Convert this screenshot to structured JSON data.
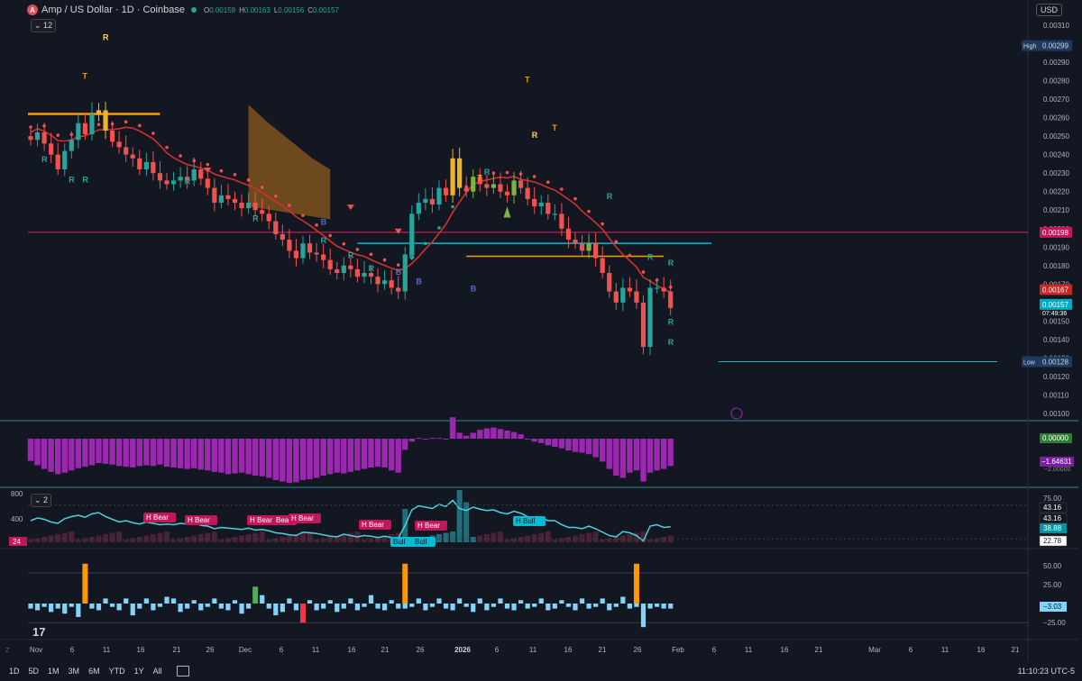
{
  "header": {
    "symbol": "Amp / US Dollar · 1D · Coinbase",
    "ohlc": [
      {
        "k": "O",
        "v": "0.00159"
      },
      {
        "k": "H",
        "v": "0.00163"
      },
      {
        "k": "L",
        "v": "0.00156"
      },
      {
        "k": "C",
        "v": "0.00157"
      }
    ],
    "collapse_count": "12",
    "currency": "USD"
  },
  "chart_data": [
    {
      "type": "candlestick",
      "pane": "price",
      "y_ticks": [
        "0.00310",
        "0.00300",
        "0.00290",
        "0.00280",
        "0.00270",
        "0.00260",
        "0.00250",
        "0.00240",
        "0.00230",
        "0.00220",
        "0.00210",
        "0.00200",
        "0.00190",
        "0.00180",
        "0.00170",
        "0.00160",
        "0.00150",
        "0.00140",
        "0.00130",
        "0.00120",
        "0.00110",
        "0.00100"
      ],
      "ylim": [
        0.001,
        0.0031
      ],
      "x_ticks": [
        "Nov",
        "6",
        "11",
        "16",
        "21",
        "26",
        "Dec",
        "6",
        "11",
        "16",
        "21",
        "26",
        "2026",
        "6",
        "11",
        "16",
        "21",
        "26",
        "Feb",
        "6",
        "11",
        "16",
        "21",
        "Mar",
        "6",
        "11",
        "16",
        "21"
      ],
      "close": [
        0.00248,
        0.00252,
        0.00246,
        0.0024,
        0.00232,
        0.00242,
        0.00248,
        0.00257,
        0.00251,
        0.00262,
        0.00264,
        0.00253,
        0.00247,
        0.00244,
        0.0024,
        0.00238,
        0.00232,
        0.00236,
        0.0023,
        0.00226,
        0.00224,
        0.00226,
        0.00228,
        0.00226,
        0.00232,
        0.00227,
        0.00222,
        0.00214,
        0.00218,
        0.00216,
        0.00214,
        0.00211,
        0.00214,
        0.0021,
        0.00208,
        0.00204,
        0.00197,
        0.00194,
        0.00188,
        0.00184,
        0.00192,
        0.00187,
        0.00186,
        0.00183,
        0.00178,
        0.00176,
        0.0018,
        0.00178,
        0.00174,
        0.00176,
        0.00174,
        0.0017,
        0.00172,
        0.00168,
        0.00166,
        0.00186,
        0.00208,
        0.00214,
        0.00216,
        0.00213,
        0.00222,
        0.00218,
        0.00238,
        0.00222,
        0.0022,
        0.00228,
        0.00224,
        0.00222,
        0.00224,
        0.0022,
        0.00218,
        0.00226,
        0.00222,
        0.00216,
        0.00212,
        0.00214,
        0.00208,
        0.00208,
        0.002,
        0.00194,
        0.00192,
        0.00188,
        0.00192,
        0.00184,
        0.00176,
        0.00166,
        0.0016,
        0.00168,
        0.00166,
        0.0016,
        0.00136,
        0.00168,
        0.00168,
        0.00166,
        0.00157
      ],
      "levels": {
        "magenta": 0.00198,
        "cyan": 0.00192,
        "orange": 0.00185,
        "orange_top": 0.00262
      },
      "price_tags": {
        "high": "High",
        "high_val": "0.00299",
        "red": "0.00198",
        "red2": "0.00167",
        "cur": "0.00157",
        "cur_sub": "07:49:36",
        "low": "Low",
        "low_val": "0.00128"
      },
      "markers": {
        "R": "R",
        "T": "T",
        "B": "B"
      }
    },
    {
      "type": "bar",
      "pane": "momentum",
      "values": [
        -3.0,
        -3.6,
        -4.1,
        -4.5,
        -4.8,
        -4.6,
        -4.3,
        -4.0,
        -3.8,
        -3.6,
        -3.3,
        -3.4,
        -3.5,
        -3.7,
        -3.8,
        -3.9,
        -3.7,
        -3.6,
        -3.7,
        -3.5,
        -3.8,
        -3.9,
        -4.0,
        -4.1,
        -4.0,
        -4.2,
        -4.3,
        -4.5,
        -4.6,
        -4.8,
        -4.7,
        -4.6,
        -4.8,
        -5.0,
        -5.1,
        -5.3,
        -5.6,
        -5.8,
        -6.0,
        -5.9,
        -5.6,
        -5.5,
        -5.3,
        -5.0,
        -4.8,
        -4.6,
        -4.7,
        -4.5,
        -4.3,
        -4.1,
        -3.9,
        -3.8,
        -3.9,
        -4.3,
        -4.6,
        -1.5,
        -0.4,
        0.1,
        0.0,
        0.1,
        0.1,
        0.0,
        2.9,
        0.8,
        0.4,
        0.8,
        1.2,
        1.4,
        1.5,
        1.3,
        1.1,
        0.9,
        0.6,
        0.0,
        -0.4,
        -0.6,
        -0.9,
        -1.1,
        -1.3,
        -1.6,
        -1.8,
        -1.9,
        -2.1,
        -2.5,
        -3.1,
        -4.1,
        -5.0,
        -5.3,
        -4.6,
        -4.3,
        -5.8,
        -4.6,
        -4.3,
        -4.1,
        -3.7
      ],
      "labels": {
        "zero": "0.00000",
        "last": "−1.64631",
        "axis_min": "−2.00000"
      }
    },
    {
      "type": "area",
      "pane": "rsi-divergence",
      "indicator_count": "2",
      "left_labels": [
        "800",
        "400",
        "24"
      ],
      "axis": [
        "75.00",
        "43.16",
        "43.16",
        "38.88",
        "22.78",
        "25.00"
      ],
      "values": [
        52,
        56,
        54,
        50,
        48,
        55,
        58,
        60,
        57,
        62,
        64,
        58,
        54,
        50,
        52,
        49,
        47,
        50,
        48,
        46,
        47,
        46,
        48,
        47,
        49,
        45,
        44,
        40,
        42,
        41,
        40,
        39,
        41,
        38,
        39,
        37,
        34,
        33,
        31,
        30,
        35,
        34,
        33,
        31,
        29,
        28,
        32,
        30,
        28,
        30,
        29,
        27,
        29,
        27,
        26,
        45,
        68,
        74,
        72,
        70,
        76,
        73,
        82,
        70,
        67,
        72,
        69,
        67,
        68,
        64,
        62,
        66,
        63,
        58,
        55,
        56,
        52,
        52,
        46,
        42,
        42,
        40,
        44,
        40,
        35,
        30,
        28,
        36,
        34,
        30,
        22,
        44,
        46,
        42,
        43
      ],
      "divergence_tags": [
        "H Bear",
        "H Bear",
        "H Bear",
        "Bear",
        "H Bear",
        "H Bear",
        "H Bear",
        "Bull",
        "Bull",
        "H Bull"
      ]
    },
    {
      "type": "bar",
      "pane": "oscillator",
      "axis": [
        "50.00",
        "25.00",
        "−3.03",
        "−25.00"
      ],
      "values": [
        -3,
        -4,
        -2,
        -5,
        -3,
        -6,
        -2,
        -8,
        5,
        -3,
        -4,
        3,
        -2,
        -4,
        3,
        -7,
        -3,
        3,
        -4,
        -2,
        4,
        3,
        -5,
        -3,
        2,
        -4,
        -2,
        3,
        -3,
        -4,
        2,
        -6,
        -3,
        2,
        5,
        -3,
        -7,
        -5,
        3,
        -4,
        -2,
        2,
        -4,
        -3,
        2,
        -5,
        -3,
        3,
        -4,
        -2,
        5,
        -3,
        -4,
        2,
        -3,
        -3,
        -2,
        3,
        -4,
        -2,
        3,
        -3,
        -4,
        3,
        -2,
        -5,
        3,
        -4,
        -2,
        3,
        -3,
        -4,
        2,
        -3,
        -2,
        3,
        -4,
        -3,
        2,
        -2,
        -4,
        3,
        -3,
        -2,
        3,
        -4,
        -2,
        4,
        -3,
        -2,
        -14,
        -3,
        -2,
        -3,
        -3
      ],
      "spikes": [
        {
          "i": 8,
          "v": 52,
          "color": "#ff9800"
        },
        {
          "i": 55,
          "v": 52,
          "color": "#ff9800"
        },
        {
          "i": 89,
          "v": 52,
          "color": "#ff9800"
        },
        {
          "i": 33,
          "v": 22,
          "color": "#4caf50"
        },
        {
          "i": 40,
          "v": -25,
          "color": "#f23645"
        }
      ]
    }
  ],
  "bottom": {
    "timeframes": [
      "1D",
      "5D",
      "1M",
      "3M",
      "6M",
      "YTD",
      "1Y",
      "All"
    ],
    "clock": "11:10:23 UTC-5"
  },
  "colors": {
    "bg": "#131722",
    "up": "#26a69a",
    "down": "#ef5350",
    "accent": "#2962ff",
    "magenta_line": "#e91e63",
    "cyan_line": "#00bcd4",
    "orange_line": "#ff9800",
    "purple_hist": "#9c27b0"
  }
}
